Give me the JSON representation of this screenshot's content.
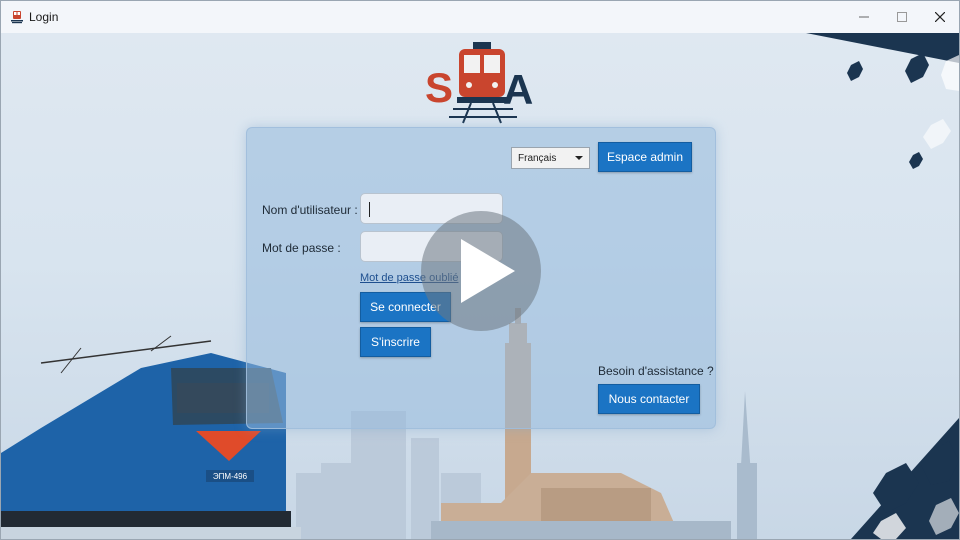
{
  "window": {
    "title": "Login",
    "controls": [
      "minimize",
      "maximize",
      "close"
    ]
  },
  "logo": {
    "letters": "SA"
  },
  "form": {
    "language_selected": "Français",
    "admin_button": "Espace admin",
    "username_label": "Nom d'utilisateur :",
    "username_value": "",
    "password_label": "Mot de passe :",
    "password_value": "",
    "forgot_link": "Mot de passe oublié",
    "login_button": "Se connecter",
    "signup_button": "S'inscrire",
    "help_text": "Besoin d'assistance ?",
    "contact_button": "Nous contacter"
  },
  "train_plate": "ЭПМ-496",
  "icons": {
    "app": "train-icon",
    "overlay": "play-icon"
  },
  "colors": {
    "primary_button": "#1b74c4",
    "logo_red": "#c9452e",
    "logo_navy": "#1b3550",
    "train_blue": "#1e63a8"
  }
}
